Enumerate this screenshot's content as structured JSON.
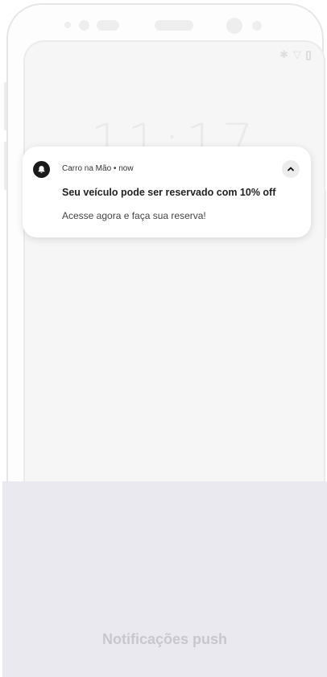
{
  "status_bar": {
    "icons": [
      "bluetooth-icon",
      "wifi-icon",
      "battery-icon"
    ]
  },
  "lock_screen": {
    "time": "11:17"
  },
  "notification": {
    "app_name": "Carro na Mão",
    "separator": "•",
    "time": "now",
    "title": "Seu veículo pode ser reservado com 10% off",
    "body": "Acesse agora e faça sua reserva!",
    "icon": "bell-icon",
    "expand_icon": "chevron-up-icon"
  },
  "caption": {
    "text": "Notificações push"
  }
}
